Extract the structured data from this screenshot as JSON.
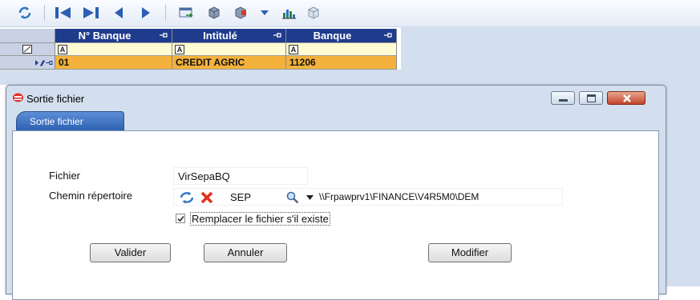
{
  "toolbar": {
    "icons": [
      "refresh-icon",
      "first-record-icon",
      "last-record-icon",
      "previous-record-icon",
      "next-record-icon",
      "export-icon",
      "add-record-icon",
      "delete-record-icon",
      "dropdown-icon",
      "chart-icon",
      "cube-icon"
    ]
  },
  "grid": {
    "columns": [
      {
        "label": "N° Banque"
      },
      {
        "label": "Intitulé"
      },
      {
        "label": "Banque"
      }
    ],
    "filter_marker": "A",
    "row": {
      "num": "01",
      "intitule": "CREDIT AGRIC",
      "banque": "11206"
    }
  },
  "dialog": {
    "title": "Sortie fichier",
    "tab_label": "Sortie fichier",
    "fichier_label": "Fichier",
    "fichier_value": "VirSepaBQ",
    "chemin_label": "Chemin répertoire",
    "chemin_code": "SEP",
    "chemin_path": "\\\\Frpawprv1\\FINANCE\\V4R5M0\\DEM",
    "replace_label": "Remplacer le fichier s'il existe",
    "replace_checked": true,
    "buttons": {
      "valider": "Valider",
      "annuler": "Annuler",
      "modifier": "Modifier"
    }
  },
  "colors": {
    "header_bg": "#1f3b8c",
    "selected_row_bg": "#f4b23c",
    "filter_row_bg": "#fffcd4",
    "dialog_bg": "#d3dfee",
    "tab_bg": "#2d61b3"
  }
}
